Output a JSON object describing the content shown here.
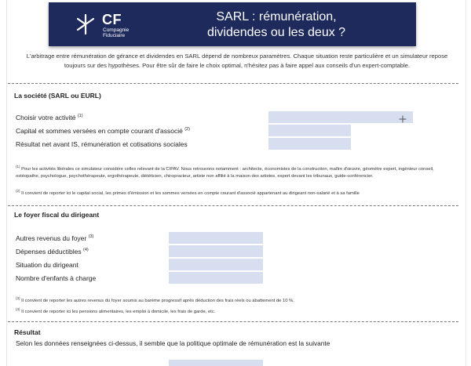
{
  "header": {
    "logo_initials": "CF",
    "logo_subtitle_line1": "Compagnie",
    "logo_subtitle_line2": "Fiduciaire",
    "title_line1": "SARL : rémunération,",
    "title_line2": "dividendes ou les deux ?",
    "background": "#1f2a5c"
  },
  "intro": "L'arbitrage entre rémunération de gérance et dividendes en SARL dépend de nombreux paramètres. Chaque situation reste particulière et un simulateur repose toujours sur des hypothèses. Pour être sûr de faire le choix optimal, n'hésitez pas à faire appel aux conseils d'un expert-comptable.",
  "societe": {
    "title": "La société (SARL ou EURL)",
    "fields": [
      {
        "label": "Choisir votre activité",
        "sup": "(1)",
        "value": ""
      },
      {
        "label": "Capital et sommes versées en compte courant d'associé",
        "sup": "(2)",
        "value": ""
      },
      {
        "label": "Résultat net avant IS, rémunération et cotisations sociales",
        "sup": "",
        "value": ""
      }
    ],
    "note1_sup": "(1)",
    "note1": "Pour les activités libérales ce simulateur considère celles relevant de la CIPAV. Nous retrouvons notamment : architecte, économistes de la construction, maître d'œuvre, géomètre expert, ingénieur conseil, ostéopathe, psychologue, psychothérapeute, ergothérapeute, diététicien, chiropracteur, artiste non affilié à la maison des artistes, expert devant les tribunaux, guide-conférencier.",
    "note2_sup": "(2)",
    "note2": "Il convient de reporter ici le capital social, les primes d'émission et les sommes versées en compte courant d'associé appartenant au dirigeant non-salarié et à sa famille"
  },
  "foyer": {
    "title": "Le foyer fiscal du dirigeant",
    "fields": [
      {
        "label": "Autres revenus du foyer",
        "sup": "(3)",
        "value": ""
      },
      {
        "label": "Dépenses déductibles",
        "sup": "(4)",
        "value": ""
      },
      {
        "label": "Situation du dirigeant",
        "sup": "",
        "value": ""
      },
      {
        "label": "Nombre d'enfants à charge",
        "sup": "",
        "value": ""
      }
    ],
    "note3_sup": "(3)",
    "note3": "Il convient de reporter les autres revenus du foyer soumis au barème progressif après déduction des frais réels ou abattement de 10 %.",
    "note4_sup": "(4)",
    "note4": "Il convient de reporter ici les pensions alimentaires, les emploi à domicile, les frais de garde, etc."
  },
  "resultat": {
    "title": "Résultat",
    "text": "Selon les données renseignées ci-dessus, il semble que la politique optimale de rémunération est la suivante"
  },
  "colors": {
    "field": "#d6deef",
    "banner": "#1f2a5c"
  }
}
